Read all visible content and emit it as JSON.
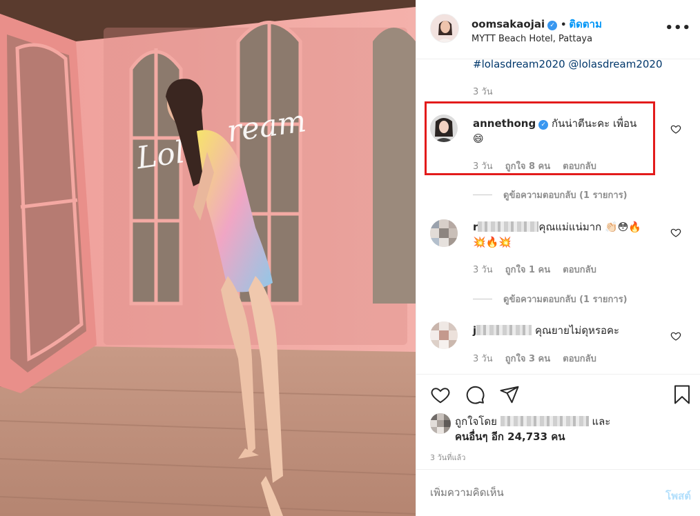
{
  "post": {
    "username": "oomsakaojai",
    "verified_icon": "verified-badge-icon",
    "separator": "•",
    "follow_label": "ติดตาม",
    "location": "MYTT Beach Hotel, Pattaya",
    "more_icon": "more-options-icon",
    "more_glyph": "•••"
  },
  "caption": {
    "tags": "#lolasdream2020 @lolasdream2020",
    "time": "3 วัน"
  },
  "comments": [
    {
      "username": "annethong",
      "verified": true,
      "text": "กันน่าตีนะคะ เพื่อน",
      "emoji": "😄",
      "time": "3 วัน",
      "likes": "ถูกใจ 8 คน",
      "reply_label": "ตอบกลับ",
      "view_replies": "ดูข้อความตอบกลับ (1 รายการ)"
    },
    {
      "username_visible": "r",
      "text": "คุณแม่แน่มาก",
      "emoji": "👏🏻😳🔥",
      "emoji_line2": "💥🔥💥",
      "time": "3 วัน",
      "likes": "ถูกใจ 1 คน",
      "reply_label": "ตอบกลับ",
      "view_replies": "ดูข้อความตอบกลับ (1 รายการ)"
    },
    {
      "username_visible": "j",
      "text": "คุณยายไม่ดุหรอคะ",
      "time": "3 วัน",
      "likes": "ถูกใจ 3 คน",
      "reply_label": "ตอบกลับ"
    }
  ],
  "actions": {
    "like_icon": "heart-icon",
    "comment_icon": "comment-icon",
    "share_icon": "share-icon",
    "save_icon": "bookmark-icon"
  },
  "likes": {
    "prefix": "ถูกใจโดย",
    "and_label": "และ",
    "others": "คนอื่นๆ อีก 24,733 คน"
  },
  "time_ago": "3 วันที่แล้ว",
  "add_comment": {
    "placeholder": "เพิ่มความคิดเห็น",
    "post_label": "โพสต์"
  },
  "colors": {
    "link_blue": "#0095f6",
    "highlight_red": "#e31b1b",
    "wall_pink": "#f2a8a3"
  }
}
